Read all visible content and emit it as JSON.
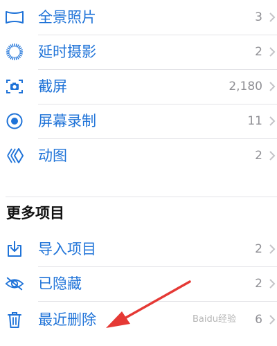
{
  "colors": {
    "accent": "#1f73d8",
    "count": "#8e8e93",
    "separator": "#e2e2e6",
    "annotation_arrow": "#e53935"
  },
  "media_types": [
    {
      "label": "全景照片",
      "count": "3",
      "icon": "panorama-icon"
    },
    {
      "label": "延时摄影",
      "count": "2",
      "icon": "timelapse-icon"
    },
    {
      "label": "截屏",
      "count": "2,180",
      "icon": "screenshot-icon"
    },
    {
      "label": "屏幕录制",
      "count": "11",
      "icon": "screen-recording-icon"
    },
    {
      "label": "动图",
      "count": "2",
      "icon": "animated-icon"
    }
  ],
  "more_items": {
    "title": "更多项目",
    "items": [
      {
        "label": "导入项目",
        "count": "2",
        "icon": "import-icon"
      },
      {
        "label": "已隐藏",
        "count": "2",
        "icon": "hidden-eye-icon"
      },
      {
        "label": "最近删除",
        "count": "6",
        "icon": "trash-icon"
      }
    ]
  },
  "watermark": "Baidu经验"
}
